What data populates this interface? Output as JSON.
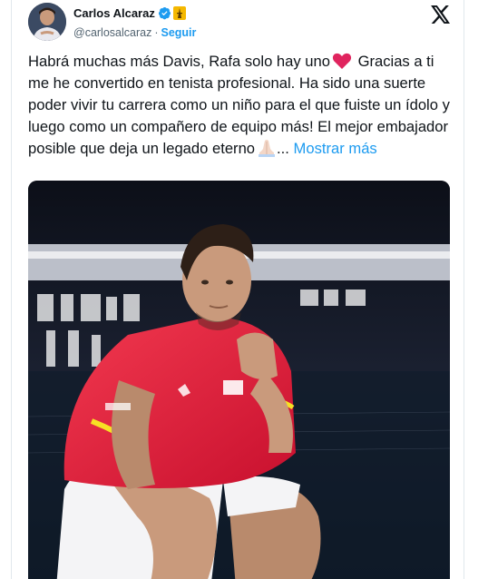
{
  "tweet": {
    "author": {
      "display_name": "Carlos Alcaraz",
      "handle": "@carlosalcaraz",
      "separator": "·",
      "follow_label": "Seguir",
      "avatar_icon": "avatar-photo",
      "badges": [
        "verified-icon",
        "tower-icon"
      ]
    },
    "logo_icon": "x-logo-icon",
    "text_part1": "Habrá muchas más Davis, Rafa solo hay uno",
    "text_part2": " Gracias a ti me he convertido en tenista profesional. Ha sido una suerte poder vivir tu carrera como un niño para el que fuiste un ídolo y luego como un compañero de equipo más! El mejor embajador posible que deja un legado eterno",
    "ellipsis": "...",
    "show_more": "Mostrar más",
    "emoji": [
      "heart-icon",
      "praying-hands-icon"
    ],
    "media": {
      "type": "photo",
      "subject": "tennis-player-crouching-photo"
    },
    "colors": {
      "accent": "#1d9bf0",
      "text": "#0f1419",
      "muted": "#536471",
      "heart": "#f91880"
    }
  }
}
